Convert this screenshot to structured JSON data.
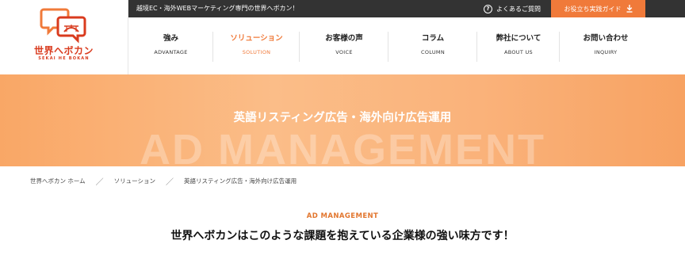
{
  "brand": {
    "name": "世界へボカン",
    "sub": "SEKAI HE BOKAN"
  },
  "topbar": {
    "tagline": "越境EC・海外WEBマーケティング専門の世界へボカン！",
    "faq_label": "よくあるご質問",
    "faq_icon": "question-circle-icon",
    "guide_label": "お役立ち実践ガイド",
    "guide_icon": "download-icon",
    "bg_color": "#333333",
    "accent_color": "#f07a3a"
  },
  "nav": {
    "items": [
      {
        "jp": "強み",
        "en": "ADVANTAGE",
        "active": false
      },
      {
        "jp": "ソリューション",
        "en": "SOLUTION",
        "active": true
      },
      {
        "jp": "お客様の声",
        "en": "VOICE",
        "active": false
      },
      {
        "jp": "コラム",
        "en": "COLUMN",
        "active": false
      },
      {
        "jp": "弊社について",
        "en": "ABOUT US",
        "active": false
      },
      {
        "jp": "お問い合わせ",
        "en": "INQUIRY",
        "active": false
      }
    ]
  },
  "hero": {
    "title": "英語リスティング広告・海外向け広告運用",
    "bg_text": "AD MANAGEMENT"
  },
  "breadcrumb": {
    "items": [
      "世界へボカン ホーム",
      "ソリューション",
      "英語リスティング広告・海外向け広告運用"
    ],
    "separator": "／"
  },
  "section": {
    "label": "AD MANAGEMENT",
    "heading": "世界へボカンはこのような課題を抱えている企業様の強い味方です！"
  }
}
